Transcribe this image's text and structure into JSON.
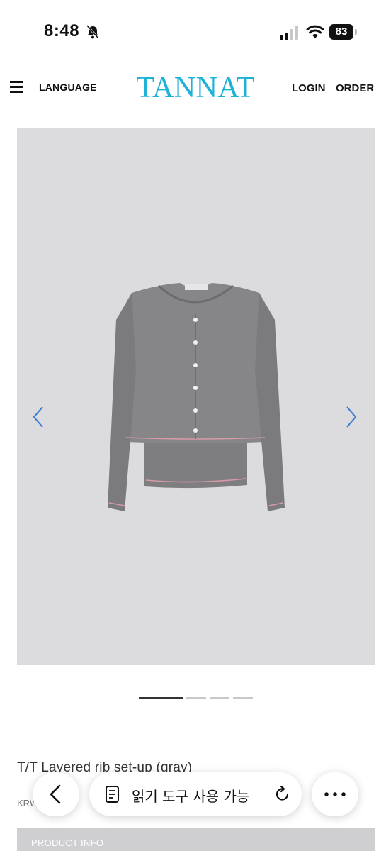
{
  "status_bar": {
    "time": "8:48",
    "battery": "83",
    "icons": [
      "bell-slash-icon",
      "signal-icon",
      "wifi-icon",
      "battery-icon"
    ]
  },
  "header": {
    "language_label": "LANGUAGE",
    "logo_text": "TANNAT",
    "login_label": "LOGIN",
    "order_label": "ORDER",
    "logo_color": "#1fb2d6"
  },
  "gallery": {
    "background_color": "#dcdcdf",
    "arrow_color": "#3a7bd5",
    "slide_count": 4,
    "active_slide": 1
  },
  "product": {
    "title": "T/T Layered rib set-up (gray)",
    "price": "KRW 00,000"
  },
  "browser_toolbar": {
    "reader_label": "읽기 도구 사용 가능"
  },
  "info_section": {
    "label": "PRODUCT INFO"
  }
}
